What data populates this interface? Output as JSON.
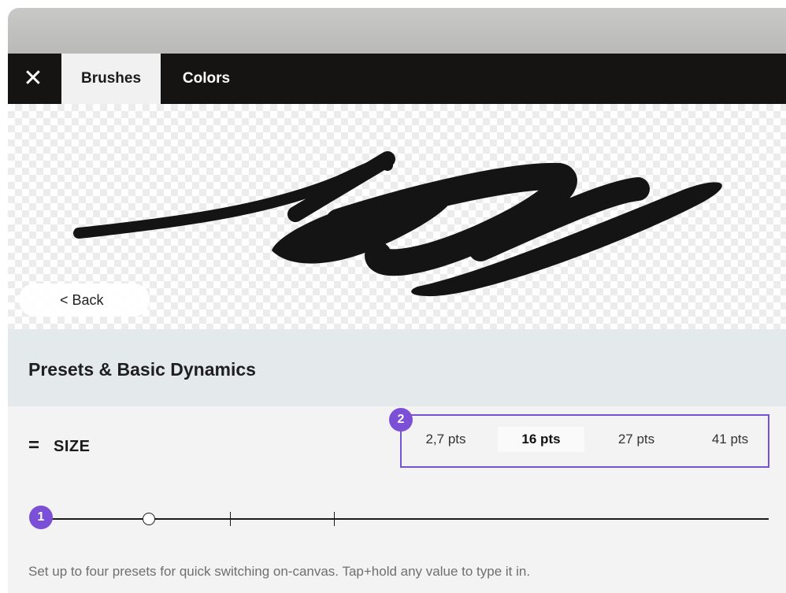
{
  "tabs": [
    {
      "label": "Brushes",
      "active": true
    },
    {
      "label": "Colors",
      "active": false
    }
  ],
  "icons": {
    "close": "close-icon",
    "drag": "drag-handle-icon"
  },
  "canvas": {
    "back_label": "< Back"
  },
  "section": {
    "title": "Presets & Basic Dynamics"
  },
  "size": {
    "handle": "=",
    "label": "SIZE",
    "presets": [
      "2,7 pts",
      "16 pts",
      "27 pts",
      "41 pts"
    ],
    "selected_preset": "16 pts",
    "help": "Set up to four presets for quick switching on-canvas. Tap+hold any value to type it in."
  },
  "badges": [
    "1",
    "2"
  ],
  "colors": {
    "accent": "#7b4fd6",
    "tabbar": "#161412",
    "stroke": "#141414"
  }
}
